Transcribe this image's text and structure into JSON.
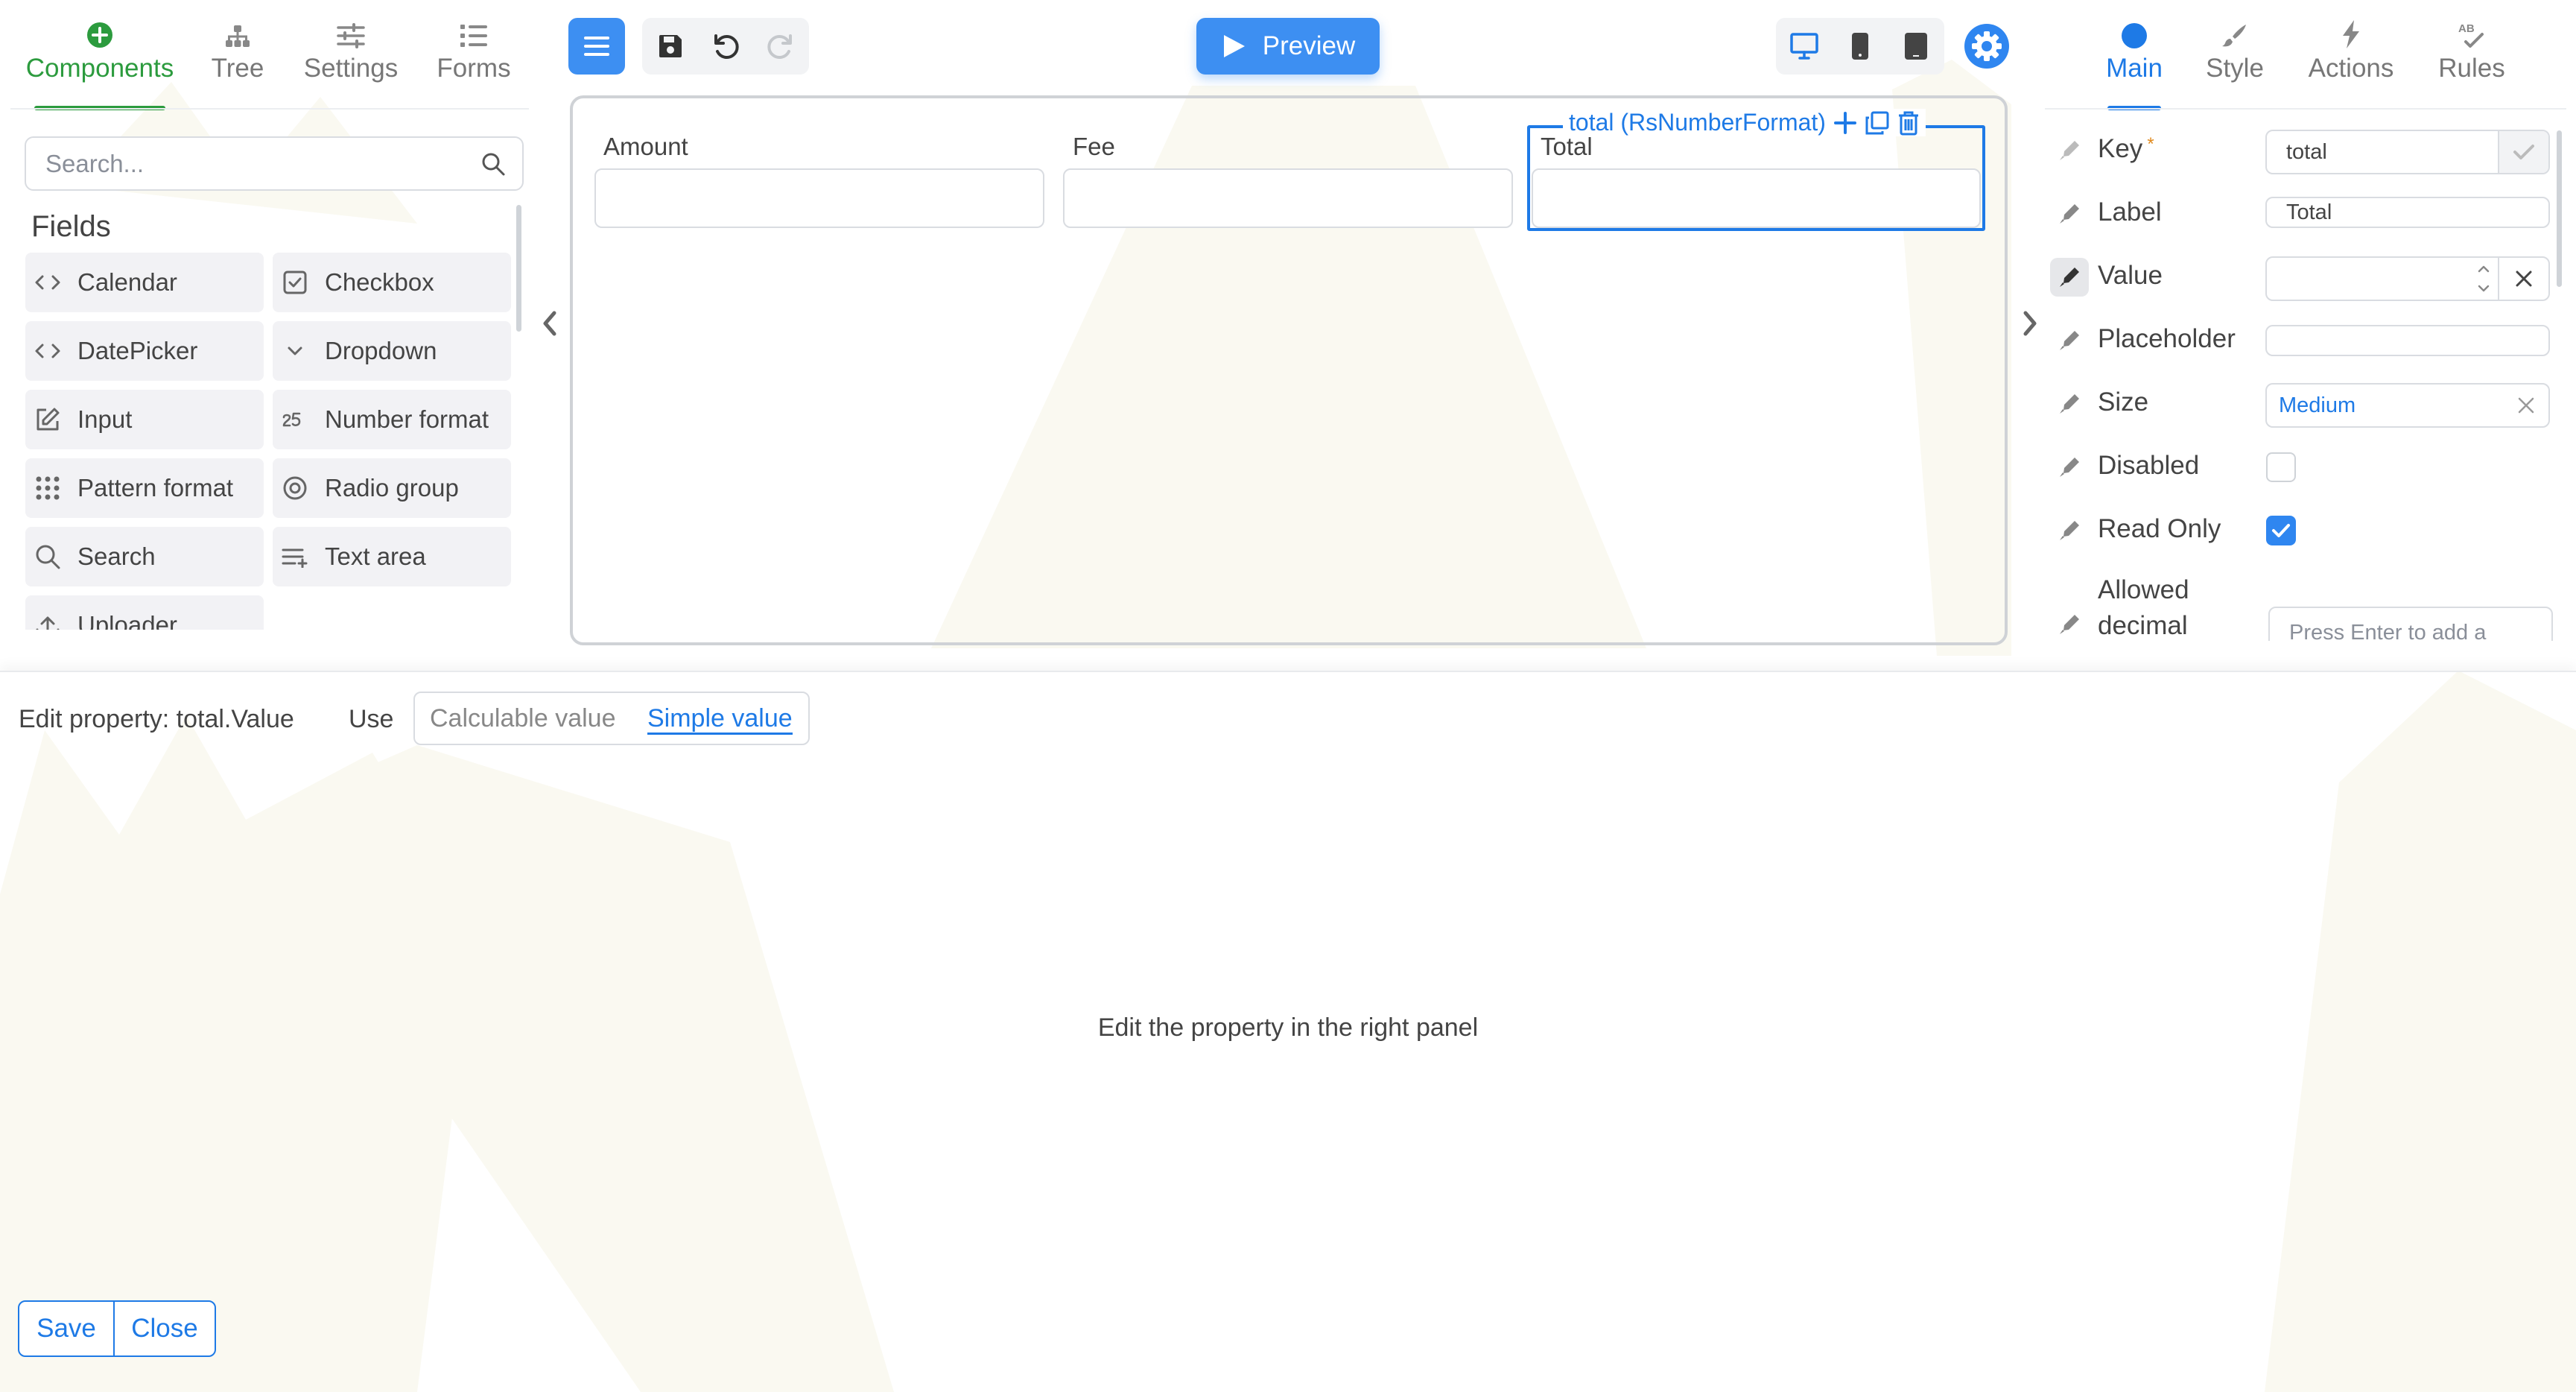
{
  "left_tabs": [
    {
      "label": "Components",
      "icon": "plus-circle-icon",
      "active": true
    },
    {
      "label": "Tree",
      "icon": "tree-icon",
      "active": false
    },
    {
      "label": "Settings",
      "icon": "sliders-icon",
      "active": false
    },
    {
      "label": "Forms",
      "icon": "list-icon",
      "active": false
    }
  ],
  "search": {
    "placeholder": "Search..."
  },
  "components": {
    "section_title": "Fields",
    "items": [
      {
        "label": "Calendar",
        "icon": "code-icon"
      },
      {
        "label": "Checkbox",
        "icon": "checkbox-icon"
      },
      {
        "label": "DatePicker",
        "icon": "code-icon"
      },
      {
        "label": "Dropdown",
        "icon": "chevron-down-icon"
      },
      {
        "label": "Input",
        "icon": "edit-icon"
      },
      {
        "label": "Number format",
        "icon": "number-icon"
      },
      {
        "label": "Pattern format",
        "icon": "grid-dots-icon"
      },
      {
        "label": "Radio group",
        "icon": "radio-icon"
      },
      {
        "label": "Search",
        "icon": "search-icon"
      },
      {
        "label": "Text area",
        "icon": "text-area-icon"
      },
      {
        "label": "Uploader",
        "icon": "upload-icon"
      }
    ]
  },
  "toolbar": {
    "preview_label": "Preview",
    "colors": {
      "primary": "#3d8ff2",
      "accent_blue": "#1e7ae6",
      "accent_green": "#2c9b3e"
    }
  },
  "canvas": {
    "fields": [
      {
        "label": "Amount"
      },
      {
        "label": "Fee"
      },
      {
        "label": "Total"
      }
    ],
    "selected_component": "total (RsNumberFormat)"
  },
  "right_tabs": [
    {
      "label": "Main",
      "icon": "circle-icon",
      "active": true
    },
    {
      "label": "Style",
      "icon": "brush-icon",
      "active": false
    },
    {
      "label": "Actions",
      "icon": "lightning-icon",
      "active": false
    },
    {
      "label": "Rules",
      "icon": "spellcheck-icon",
      "active": false
    }
  ],
  "properties": {
    "key": {
      "label": "Key",
      "required_mark": "*",
      "value": "total"
    },
    "label": {
      "label": "Label",
      "value": "Total"
    },
    "value": {
      "label": "Value",
      "value": ""
    },
    "placeholder": {
      "label": "Placeholder",
      "value": ""
    },
    "size": {
      "label": "Size",
      "value": "Medium"
    },
    "disabled": {
      "label": "Disabled",
      "checked": false
    },
    "read_only": {
      "label": "Read Only",
      "checked": true
    },
    "allowed_decimal": {
      "label_line1": "Allowed",
      "label_line2": "decimal",
      "placeholder": "Press Enter to add a"
    }
  },
  "editor": {
    "title": "Edit property: total.Value",
    "use_label": "Use",
    "options": [
      "Calculable value",
      "Simple value"
    ],
    "selected_option": "Simple value",
    "message": "Edit the property in the right panel",
    "save_label": "Save",
    "close_label": "Close"
  }
}
